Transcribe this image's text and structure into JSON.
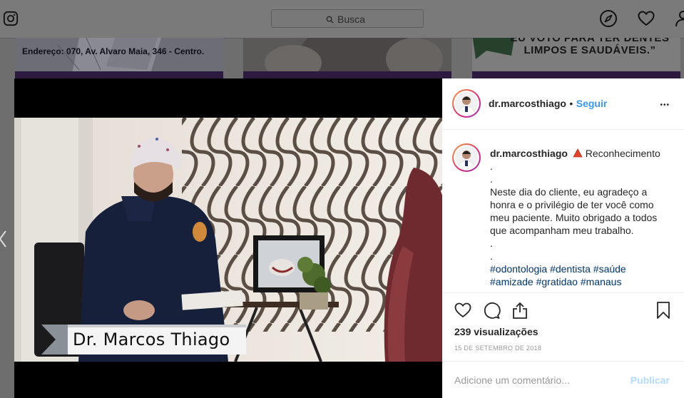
{
  "nav": {
    "search_placeholder": "Busca"
  },
  "background_posts": {
    "tile1_text": "Endereço: 070, Av. Alvaro Maia, 346 - Centro.",
    "tile3_quote_line1": "EU VOTO PARA TER DENTES",
    "tile3_quote_line2": "LIMPOS E SAUDÁVEIS.”"
  },
  "video": {
    "lower_third": "Dr. Marcos Thiago"
  },
  "post": {
    "username": "dr.marcosthiago",
    "separator": "•",
    "follow_label": "Seguir",
    "more_label": "•••",
    "caption": {
      "username": "dr.marcosthiago",
      "title": "Reconhecimento",
      "lines": [
        ".",
        ".",
        "Neste dia do cliente, eu agradeço a honra e o privilégio de ter você como meu paciente. Muito obrigado a todos que acompanham meu trabalho.",
        ".",
        "."
      ],
      "hashtags_line1": "#odontologia #dentista #saúde",
      "hashtags_line2": "#amizade #gratidao #manaus"
    },
    "views": "239 visualizações",
    "date": "15 DE SETEMBRO DE 2018",
    "comment_placeholder": "Adicione um comentário...",
    "publish_label": "Publicar"
  },
  "colors": {
    "link_blue": "#3897f0",
    "hashtag_blue": "#003569",
    "publish_disabled": "#b3dbff"
  },
  "icons": [
    "instagram-icon",
    "search-icon",
    "compass-icon",
    "heart-icon",
    "profile-icon",
    "left-chevron-icon",
    "warning-triangle-icon",
    "like-icon",
    "comment-icon",
    "share-icon",
    "bookmark-icon"
  ]
}
